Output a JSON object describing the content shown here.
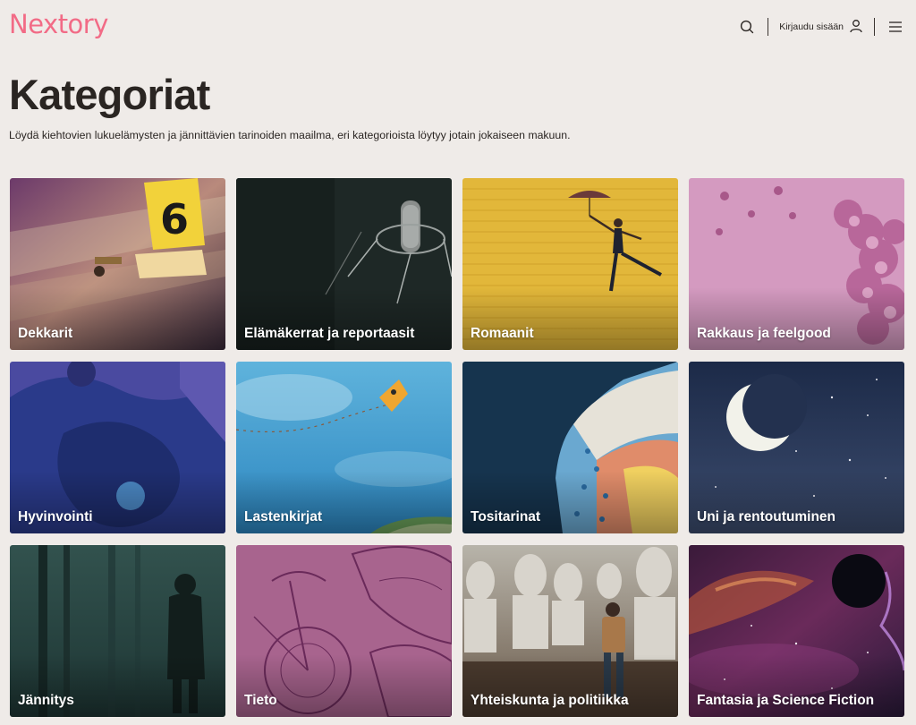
{
  "header": {
    "logo": "Nextory",
    "login_label": "Kirjaudu sisään",
    "icons": {
      "search": "search-icon",
      "user": "user-icon",
      "menu": "menu-icon"
    },
    "brand_color": "#f26b86"
  },
  "page": {
    "title": "Kategoriat",
    "subtitle": "Löydä kiehtovien lukuelämysten ja jännittävien tarinoiden maailma, eri kategorioista löytyy jotain jokaiseen makuun."
  },
  "categories": [
    {
      "label": "Dekkarit",
      "image": "crime-scene-evidence-marker-6",
      "color": "#a05a88"
    },
    {
      "label": "Elämäkerrat ja reportaasit",
      "image": "studio-microphone",
      "color": "#1f2a28"
    },
    {
      "label": "Romaanit",
      "image": "woman-with-umbrella-yellow-wall",
      "color": "#e1b638"
    },
    {
      "label": "Rakkaus ja feelgood",
      "image": "pink-lilac-flowers",
      "color": "#cf8ab6"
    },
    {
      "label": "Hyvinvointi",
      "image": "blue-abstract-paint",
      "color": "#243c86"
    },
    {
      "label": "Lastenkirjat",
      "image": "kite-in-blue-sky",
      "color": "#3c9ccc"
    },
    {
      "label": "Tositarinat",
      "image": "illustrated-head-profile-rain",
      "color": "#16344e"
    },
    {
      "label": "Uni ja rentoutuminen",
      "image": "crescent-moon-night-sky",
      "color": "#2a3a5c"
    },
    {
      "label": "Jännitys",
      "image": "figure-in-misty-forest",
      "color": "#23413e"
    },
    {
      "label": "Tieto",
      "image": "bicycle-and-butterfly-sketch",
      "color": "#a6648e"
    },
    {
      "label": "Yhteiskunta ja politiikka",
      "image": "presidential-busts-statues",
      "color": "#8a8478"
    },
    {
      "label": "Fantasia ja Science Fiction",
      "image": "planet-and-nebula",
      "color": "#4c1e4c"
    }
  ]
}
